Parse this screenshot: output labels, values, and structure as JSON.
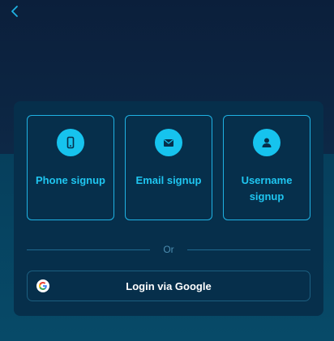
{
  "header": {
    "back_icon": "chevron-left-icon"
  },
  "signup_options": [
    {
      "label": "Phone signup",
      "icon": "phone-icon"
    },
    {
      "label": "Email signup",
      "icon": "envelope-icon"
    },
    {
      "label": "Username signup",
      "icon": "user-icon"
    }
  ],
  "divider": {
    "text": "Or"
  },
  "google": {
    "label": "Login via Google",
    "icon": "google-icon"
  },
  "colors": {
    "accent": "#16c3ee",
    "card_bg": "#062f4b",
    "page_top": "#0b1f3b",
    "page_bottom": "#074a68"
  }
}
